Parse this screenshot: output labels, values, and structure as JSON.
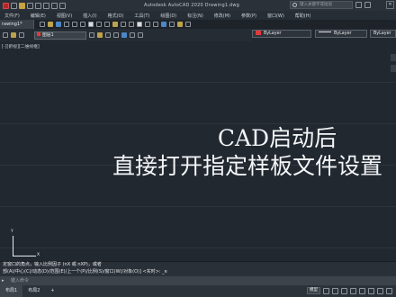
{
  "window": {
    "title": "Autodesk AutoCAD 2020    Drawing1.dwg",
    "search_placeholder": "键入关键字或短语"
  },
  "menu": [
    "文件(F)",
    "编辑(E)",
    "视图(V)",
    "插入(I)",
    "格式(O)",
    "工具(T)",
    "绘图(D)",
    "标注(N)",
    "修改(M)",
    "参数(P)",
    "窗口(W)",
    "帮助(H)"
  ],
  "tabs": {
    "document": "rawing1*"
  },
  "properties": {
    "color": "ByLayer",
    "linetype": "ByLayer",
    "lineweight": "ByLayer",
    "layer": "图层1"
  },
  "canvas": {
    "viewport_label": "[-][俯视][二维线框]",
    "overlay_line1": "CAD启动后",
    "overlay_line2": "直接打开指定样板文件设置",
    "ucs_y": "Y",
    "ucs_x": "X"
  },
  "command": {
    "history_line1": "定窗口的角点，输入比例因子 (nX 或 nXP)，或者",
    "history_line2": "部(A)/中心(C)/动态(D)/范围(E)/上一个(P)/比例(S)/窗口(W)/对象(O)] <实时>: _e",
    "input_placeholder": "键入命令"
  },
  "status": {
    "layouts": [
      "布局1",
      "布局2"
    ],
    "model_label": "模型"
  }
}
